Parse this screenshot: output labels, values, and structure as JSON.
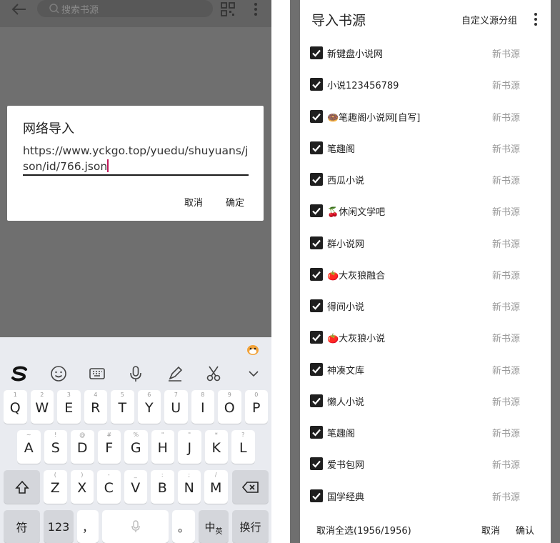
{
  "left": {
    "search_placeholder": "搜索书源",
    "dialog": {
      "title": "网络导入",
      "url": "https://www.yckgo.top/yuedu/shuyuans/json/id/766.json",
      "cancel": "取消",
      "ok": "确定"
    },
    "keyboard": {
      "row1": [
        {
          "ch": "Q",
          "hint": "1"
        },
        {
          "ch": "W",
          "hint": "2"
        },
        {
          "ch": "E",
          "hint": "3"
        },
        {
          "ch": "R",
          "hint": "4"
        },
        {
          "ch": "T",
          "hint": "5"
        },
        {
          "ch": "Y",
          "hint": "6"
        },
        {
          "ch": "U",
          "hint": "7"
        },
        {
          "ch": "I",
          "hint": "8"
        },
        {
          "ch": "O",
          "hint": "9"
        },
        {
          "ch": "P",
          "hint": "0"
        }
      ],
      "row2": [
        {
          "ch": "A",
          "hint": "~"
        },
        {
          "ch": "S",
          "hint": "!"
        },
        {
          "ch": "D",
          "hint": "@"
        },
        {
          "ch": "F",
          "hint": "#"
        },
        {
          "ch": "G",
          "hint": "%"
        },
        {
          "ch": "H",
          "hint": "\""
        },
        {
          "ch": "J",
          "hint": "\""
        },
        {
          "ch": "K",
          "hint": "*"
        },
        {
          "ch": "L",
          "hint": "?"
        }
      ],
      "row3": [
        {
          "ch": "Z",
          "hint": "("
        },
        {
          "ch": "X",
          "hint": ")"
        },
        {
          "ch": "C",
          "hint": "-"
        },
        {
          "ch": "V",
          "hint": "_"
        },
        {
          "ch": "B",
          "hint": ":"
        },
        {
          "ch": "N",
          "hint": ";"
        },
        {
          "ch": "M",
          "hint": "/"
        }
      ],
      "symbols": "符",
      "numbers": "123",
      "comma": "，",
      "period": "。",
      "lang": "中",
      "lang_sub": "英",
      "enter": "换行"
    }
  },
  "right": {
    "title": "导入书源",
    "group_button": "自定义源分组",
    "tag": "新书源",
    "items": [
      {
        "name": "新键盘小说网"
      },
      {
        "name": "小说123456789"
      },
      {
        "name": "🍩笔趣阁小说网[自写]"
      },
      {
        "name": "笔趣阁"
      },
      {
        "name": "西瓜小说"
      },
      {
        "name": "🍒休闲文学吧"
      },
      {
        "name": "群小说网"
      },
      {
        "name": "🍅大灰狼融合"
      },
      {
        "name": "得间小说"
      },
      {
        "name": "🍅大灰狼小说"
      },
      {
        "name": "神凑文库"
      },
      {
        "name": "懒人小说"
      },
      {
        "name": "笔趣阁"
      },
      {
        "name": "爱书包网"
      },
      {
        "name": "国学经典"
      }
    ],
    "footer": {
      "deselect_all": "取消全选(1956/1956)",
      "cancel": "取消",
      "confirm": "确认"
    }
  }
}
